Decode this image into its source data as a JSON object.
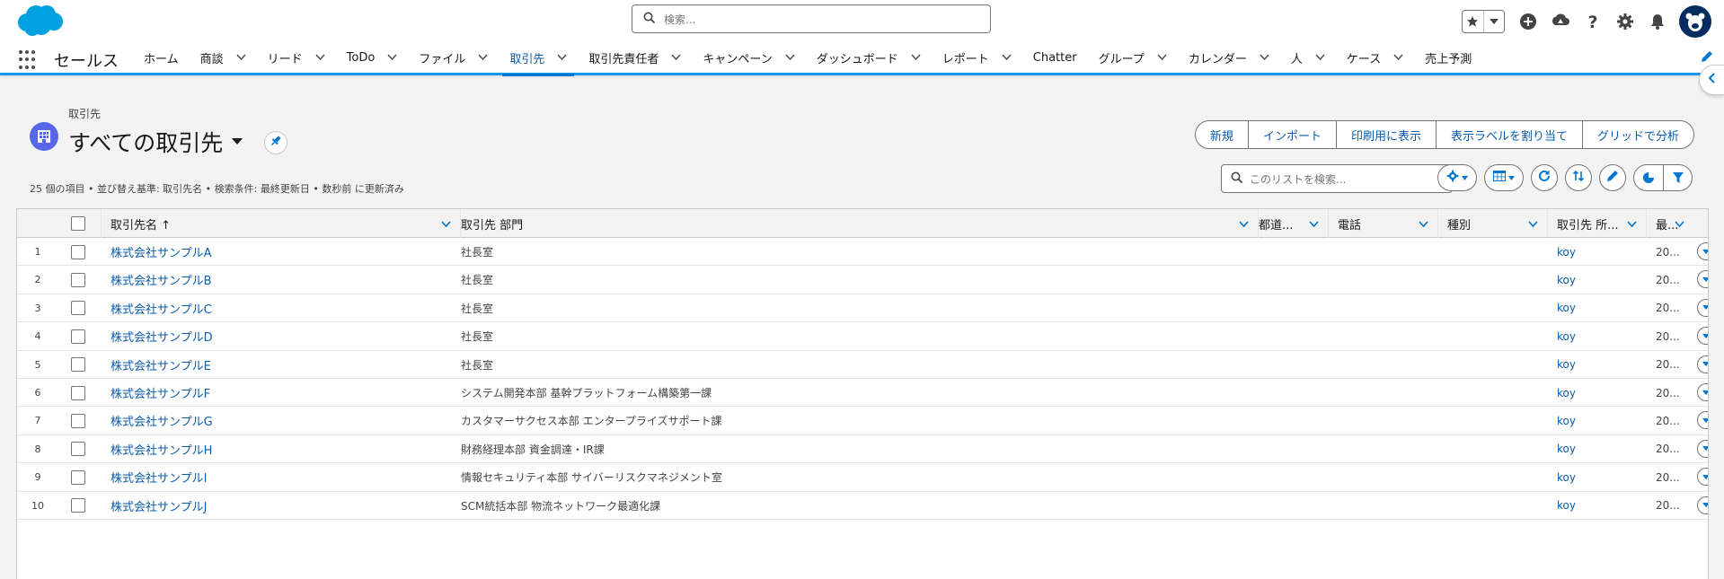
{
  "header": {
    "search_placeholder": "検索..."
  },
  "nav": {
    "app_name": "セールス",
    "items": [
      {
        "label": "ホーム",
        "has_menu": false,
        "active": false
      },
      {
        "label": "商談",
        "has_menu": true,
        "active": false
      },
      {
        "label": "リード",
        "has_menu": true,
        "active": false
      },
      {
        "label": "ToDo",
        "has_menu": true,
        "active": false
      },
      {
        "label": "ファイル",
        "has_menu": true,
        "active": false
      },
      {
        "label": "取引先",
        "has_menu": true,
        "active": true
      },
      {
        "label": "取引先責任者",
        "has_menu": true,
        "active": false
      },
      {
        "label": "キャンペーン",
        "has_menu": true,
        "active": false
      },
      {
        "label": "ダッシュボード",
        "has_menu": true,
        "active": false
      },
      {
        "label": "レポート",
        "has_menu": true,
        "active": false
      },
      {
        "label": "Chatter",
        "has_menu": false,
        "active": false
      },
      {
        "label": "グループ",
        "has_menu": true,
        "active": false
      },
      {
        "label": "カレンダー",
        "has_menu": true,
        "active": false
      },
      {
        "label": "人",
        "has_menu": true,
        "active": false
      },
      {
        "label": "ケース",
        "has_menu": true,
        "active": false
      },
      {
        "label": "売上予測",
        "has_menu": false,
        "active": false
      }
    ]
  },
  "list": {
    "breadcrumb": "取引先",
    "title": "すべての取引先",
    "actions": [
      "新規",
      "インポート",
      "印刷用に表示",
      "表示ラベルを割り当て",
      "グリッドで分析"
    ],
    "meta": "25 個の項目 • 並び替え基準: 取引先名 • 検索条件: 最終更新日 • 数秒前 に更新済み",
    "search_placeholder": "このリストを検索..."
  },
  "table": {
    "columns": [
      "取引先名 ↑",
      "取引先 部門",
      "都道...",
      "電話",
      "種別",
      "取引先 所...",
      "最..."
    ],
    "rows": [
      {
        "num": "1",
        "name": "株式会社サンプルA",
        "dept": "社長室",
        "owner": "koy",
        "last": "20..."
      },
      {
        "num": "2",
        "name": "株式会社サンプルB",
        "dept": "社長室",
        "owner": "koy",
        "last": "20..."
      },
      {
        "num": "3",
        "name": "株式会社サンプルC",
        "dept": "社長室",
        "owner": "koy",
        "last": "20..."
      },
      {
        "num": "4",
        "name": "株式会社サンプルD",
        "dept": "社長室",
        "owner": "koy",
        "last": "20..."
      },
      {
        "num": "5",
        "name": "株式会社サンプルE",
        "dept": "社長室",
        "owner": "koy",
        "last": "20..."
      },
      {
        "num": "6",
        "name": "株式会社サンプルF",
        "dept": "システム開発本部 基幹プラットフォーム構築第一課",
        "owner": "koy",
        "last": "20..."
      },
      {
        "num": "7",
        "name": "株式会社サンプルG",
        "dept": "カスタマーサクセス本部 エンタープライズサポート課",
        "owner": "koy",
        "last": "20..."
      },
      {
        "num": "8",
        "name": "株式会社サンプルH",
        "dept": "財務経理本部 資金調達・IR課",
        "owner": "koy",
        "last": "20..."
      },
      {
        "num": "9",
        "name": "株式会社サンプルI",
        "dept": "情報セキュリティ本部 サイバーリスクマネジメント室",
        "owner": "koy",
        "last": "20..."
      },
      {
        "num": "10",
        "name": "株式会社サンプルJ",
        "dept": "SCM統括本部 物流ネットワーク最適化課",
        "owner": "koy",
        "last": "20..."
      }
    ]
  },
  "colors": {
    "brand": "#00a1e0",
    "link": "#0b5cab",
    "accent": "#0176d3",
    "object_icon": "#5867e8"
  }
}
